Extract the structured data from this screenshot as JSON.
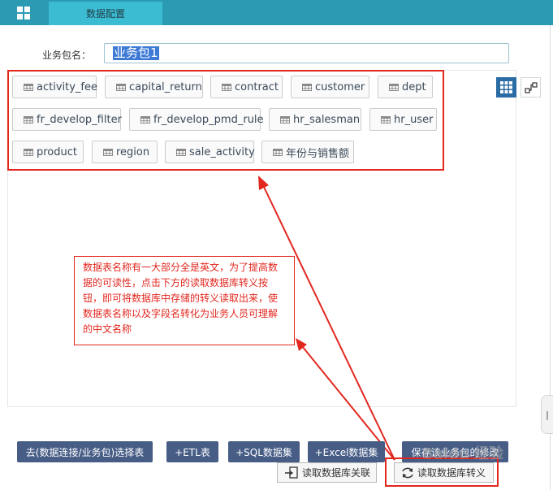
{
  "header": {
    "tab_label": "数据配置"
  },
  "package": {
    "label": "业务包名：",
    "name_value": "业务包1"
  },
  "tables": [
    {
      "label": "activity_fee"
    },
    {
      "label": "capital_return"
    },
    {
      "label": "contract"
    },
    {
      "label": "customer"
    },
    {
      "label": "dept"
    },
    {
      "label": "fr_develop_filter"
    },
    {
      "label": "fr_develop_pmd_rule"
    },
    {
      "label": "hr_salesman"
    },
    {
      "label": "hr_user"
    },
    {
      "label": "product"
    },
    {
      "label": "region"
    },
    {
      "label": "sale_activity"
    },
    {
      "label": "年份与销售额"
    }
  ],
  "annotation": {
    "text": "数据表名称有一大部分全是英文，为了提高数据的可读性，点击下方的读取数据库转义按钮，即可将数据库中存储的转义读取出来，使数据表名称以及字段名转化为业务人员可理解的中文名称"
  },
  "buttons": {
    "select_table": "去(数据连接/业务包)选择表",
    "etl": "+ETL表",
    "sql": "+SQL数据集",
    "excel": "+Excel数据集",
    "save": "保存该业务包的修改",
    "read_relation": "读取数据库关联",
    "read_escape": "读取数据库转义"
  },
  "side_handle": "|",
  "watermark": "Baidu 经验",
  "colors": {
    "topbar": "#2a9bb3",
    "tab": "#3cbcd3",
    "primary_button": "#475d86",
    "annotation_red": "#e2271f",
    "view_active": "#2c6ca5"
  },
  "icons": {
    "app_grid": "grid-icon",
    "table": "table-icon",
    "view_grid": "tile-view-icon",
    "view_relation": "relation-view-icon",
    "read_relation": "import-icon",
    "read_escape": "refresh-icon"
  }
}
